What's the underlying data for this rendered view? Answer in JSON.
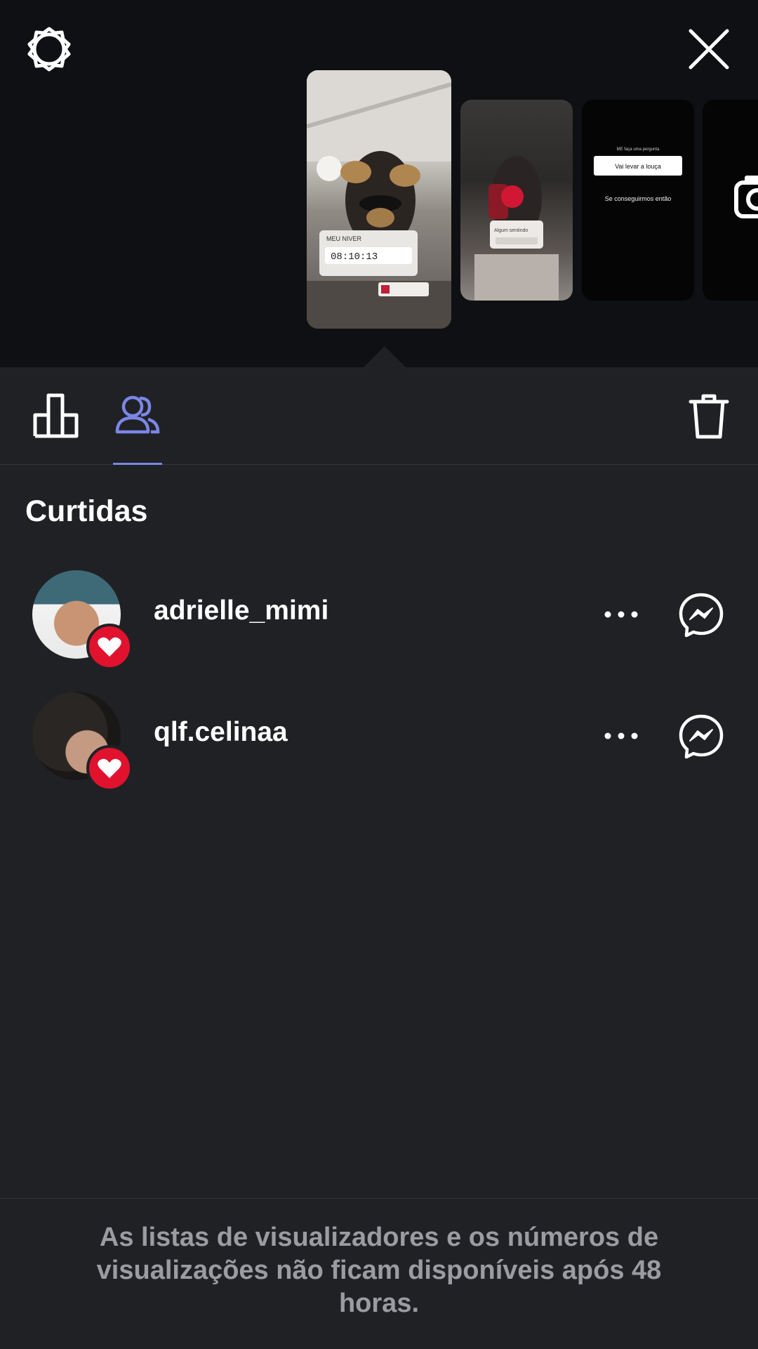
{
  "header": {
    "settings_icon": "gear-icon",
    "close_icon": "close-icon"
  },
  "stories": [
    {
      "overlay_title": "MEU NIVER",
      "countdown": "08:10:13"
    },
    {
      "overlay_text": "Algum sentindo"
    },
    {
      "question_header": "ME faça uma pergunta",
      "answer": "Vai levar a louça",
      "reply": "Se conseguirmos então"
    },
    {
      "icon": "camera-icon"
    }
  ],
  "tabs": {
    "insights_icon": "bar-chart-icon",
    "viewers_icon": "people-icon",
    "delete_icon": "trash-icon"
  },
  "section": {
    "title": "Curtidas"
  },
  "likers": [
    {
      "username": "adrielle_mimi"
    },
    {
      "username": "qlf.celinaa"
    }
  ],
  "footer": {
    "text": "As listas de visualizadores e os números de visualizações não ficam disponíveis após 48 horas."
  },
  "colors": {
    "background": "#202125",
    "top_background": "#0e1013",
    "accent": "#7b86e6",
    "like_red": "#e0122e",
    "muted_text": "#9a9ca1"
  }
}
